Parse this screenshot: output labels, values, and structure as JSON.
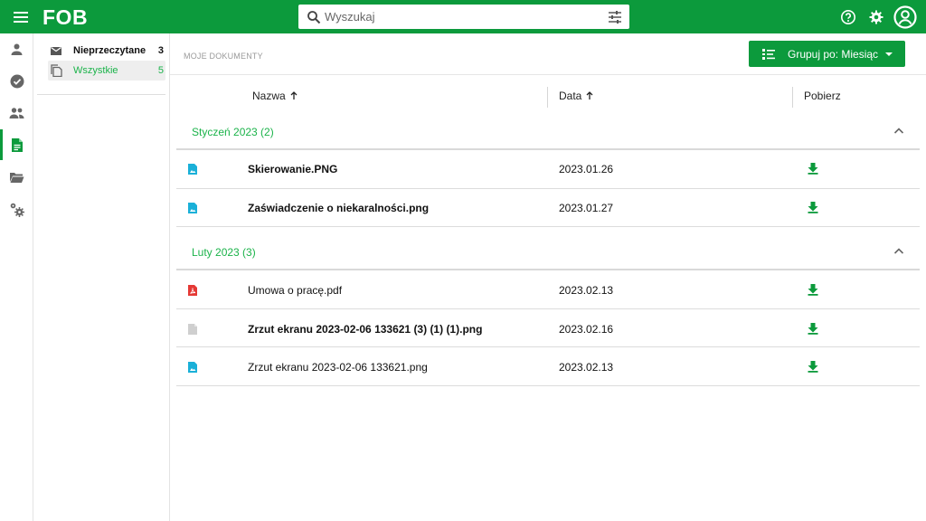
{
  "app": {
    "logo": "FOB",
    "brand_color": "#0c9a3c",
    "accent_text_color": "#1bb34a"
  },
  "search": {
    "placeholder": "Wyszukaj",
    "value": ""
  },
  "folders": [
    {
      "label": "Nieprzeczytane",
      "count": "3",
      "icon": "mail-icon",
      "selected": false
    },
    {
      "label": "Wszystkie",
      "count": "5",
      "icon": "documents-icon",
      "selected": true
    }
  ],
  "main": {
    "breadcrumb": "MOJE DOKUMENTY",
    "group_button": "Grupuj po: Miesiąc",
    "columns": {
      "name": "Nazwa",
      "date": "Data",
      "download": "Pobierz"
    }
  },
  "groups": [
    {
      "title": "Styczeń 2023 (2)",
      "files": [
        {
          "name": "Skierowanie.PNG",
          "date": "2023.01.26",
          "bold": true,
          "icon": "image-file-icon"
        },
        {
          "name": "Zaświadczenie o niekaralności.png",
          "date": "2023.01.27",
          "bold": true,
          "icon": "image-file-icon"
        }
      ]
    },
    {
      "title": "Luty 2023 (3)",
      "files": [
        {
          "name": "Umowa o pracę.pdf",
          "date": "2023.02.13",
          "bold": false,
          "icon": "pdf-file-icon"
        },
        {
          "name": "Zrzut ekranu 2023-02-06 133621 (3) (1) (1).png",
          "date": "2023.02.16",
          "bold": true,
          "icon": "generic-file-icon"
        },
        {
          "name": "Zrzut ekranu 2023-02-06 133621.png",
          "date": "2023.02.13",
          "bold": false,
          "icon": "image-file-icon"
        }
      ]
    }
  ]
}
